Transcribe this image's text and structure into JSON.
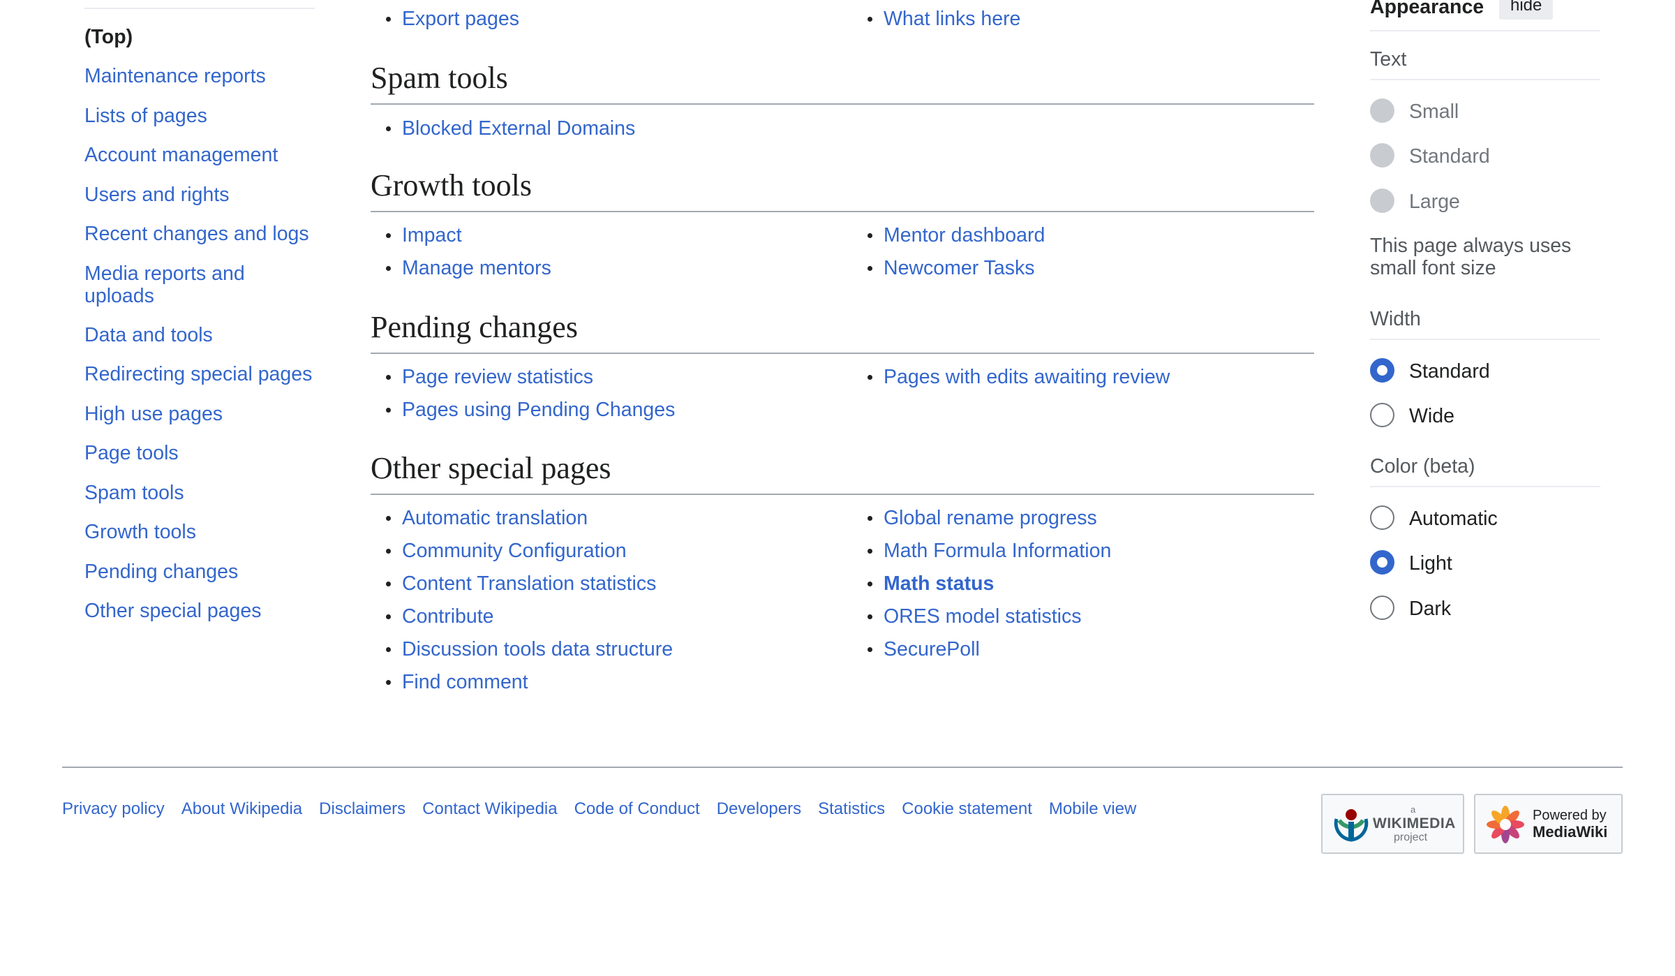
{
  "toc": {
    "items": [
      {
        "label": "(Top)"
      },
      {
        "label": "Maintenance reports"
      },
      {
        "label": "Lists of pages"
      },
      {
        "label": "Account management"
      },
      {
        "label": "Users and rights"
      },
      {
        "label": "Recent changes and logs"
      },
      {
        "label": "Media reports and uploads"
      },
      {
        "label": "Data and tools"
      },
      {
        "label": "Redirecting special pages"
      },
      {
        "label": "High use pages"
      },
      {
        "label": "Page tools"
      },
      {
        "label": "Spam tools"
      },
      {
        "label": "Growth tools"
      },
      {
        "label": "Pending changes"
      },
      {
        "label": "Other special pages"
      }
    ]
  },
  "main": {
    "page_tools_tail": {
      "left": [
        "Export pages"
      ],
      "right": [
        "What links here"
      ]
    },
    "sections": [
      {
        "title": "Spam tools",
        "left": [
          "Blocked External Domains"
        ],
        "right": []
      },
      {
        "title": "Growth tools",
        "left": [
          "Impact",
          "Manage mentors"
        ],
        "right": [
          "Mentor dashboard",
          "Newcomer Tasks"
        ]
      },
      {
        "title": "Pending changes",
        "left": [
          "Page review statistics",
          "Pages using Pending Changes"
        ],
        "right": [
          "Pages with edits awaiting review"
        ]
      },
      {
        "title": "Other special pages",
        "left": [
          "Automatic translation",
          "Community Configuration",
          "Content Translation statistics",
          "Contribute",
          "Discussion tools data structure",
          "Find comment"
        ],
        "right": [
          "Global rename progress",
          "Math Formula Information",
          "Math status",
          "ORES model statistics",
          "SecurePoll"
        ]
      }
    ]
  },
  "appearance": {
    "title": "Appearance",
    "hide_label": "hide",
    "text": {
      "label": "Text",
      "options": [
        "Small",
        "Standard",
        "Large"
      ],
      "note": "This page always uses small font size"
    },
    "width": {
      "label": "Width",
      "options": [
        "Standard",
        "Wide"
      ],
      "selected": "Standard"
    },
    "color": {
      "label": "Color (beta)",
      "options": [
        "Automatic",
        "Light",
        "Dark"
      ],
      "selected": "Light"
    }
  },
  "footer": {
    "links": [
      "Privacy policy",
      "About Wikipedia",
      "Disclaimers",
      "Contact Wikipedia",
      "Code of Conduct",
      "Developers",
      "Statistics",
      "Cookie statement",
      "Mobile view"
    ],
    "wikimedia_badge": {
      "small": "a",
      "big": "WIKIMEDIA",
      "sub": "project"
    },
    "mediawiki_badge": {
      "line1": "Powered by",
      "line2": "MediaWiki"
    }
  },
  "colors": {
    "link": "#3366cc",
    "text": "#202122",
    "rule": "#a2a9b1",
    "accent": "#3366cc"
  }
}
